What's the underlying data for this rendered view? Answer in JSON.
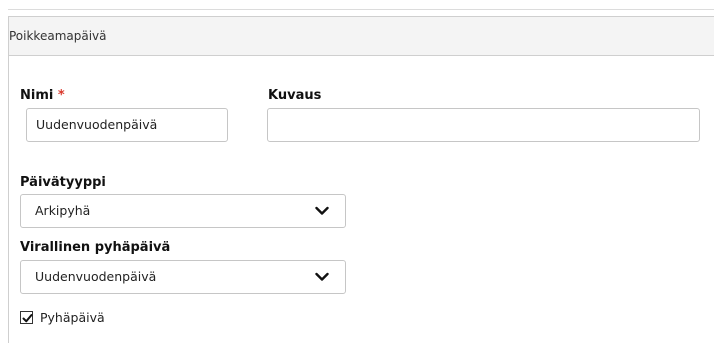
{
  "panel": {
    "title": "Poikkeamapäivä"
  },
  "form": {
    "name": {
      "label": "Nimi",
      "required_mark": "*",
      "value": "Uudenvuodenpäivä"
    },
    "description": {
      "label": "Kuvaus",
      "value": ""
    },
    "day_type": {
      "label": "Päivätyyppi",
      "selected": "Arkipyhä"
    },
    "official_holiday": {
      "label": "Virallinen pyhäpäivä",
      "selected": "Uudenvuodenpäivä"
    },
    "holiday_checkbox": {
      "label": "Pyhäpäivä",
      "checked": true
    }
  },
  "colors": {
    "required": "#d9382c",
    "border": "#c6c6c6",
    "header_bg": "#f4f4f4"
  }
}
